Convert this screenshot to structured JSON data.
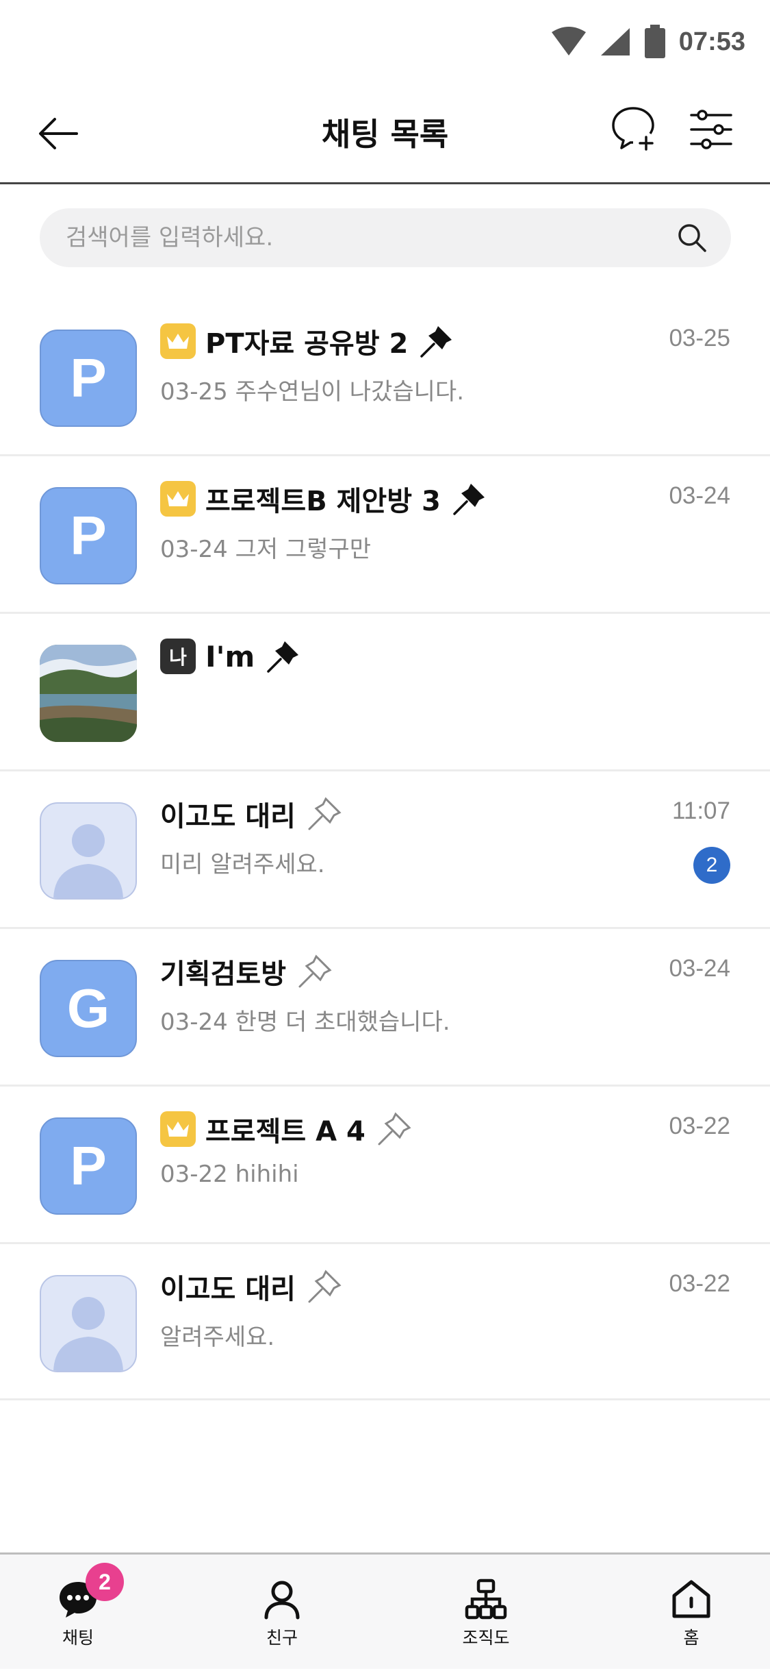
{
  "status_bar": {
    "time": "07:53",
    "icons": [
      "wifi-icon",
      "signal-icon",
      "battery-icon"
    ]
  },
  "header": {
    "title": "채팅 목록",
    "back_icon": "arrow-left-icon",
    "new_chat_icon": "chat-bubble-plus-icon",
    "settings_icon": "sliders-icon"
  },
  "search": {
    "placeholder": "검색어를 입력하세요.",
    "icon": "search-icon"
  },
  "colors": {
    "accent_blue": "#7fabef",
    "unread_badge": "#2f6cc9",
    "tab_badge": "#e8408f",
    "crown": "#f5c542"
  },
  "chats": [
    {
      "name": "PT자료 공유방 2",
      "preview": "03-25 주수연님이 나갔습니다.",
      "time": "03-25",
      "avatar_letter": "P",
      "badge": "crown",
      "pinned": true,
      "unread": ""
    },
    {
      "name": "프로젝트B 제안방 3",
      "preview": "03-24 그저 그렇구만",
      "time": "03-24",
      "avatar_letter": "P",
      "badge": "crown",
      "pinned": true,
      "unread": ""
    },
    {
      "name": "I'm",
      "preview": "",
      "time": "",
      "avatar_letter": "",
      "badge": "me",
      "badge_text": "나",
      "pinned": true,
      "unread": ""
    },
    {
      "name": "이고도 대리",
      "preview": "미리 알려주세요.",
      "time": "11:07",
      "avatar_letter": "",
      "badge": "",
      "pinned": false,
      "unread": "2"
    },
    {
      "name": "기획검토방",
      "preview": "03-24 한명 더 초대했습니다.",
      "time": "03-24",
      "avatar_letter": "G",
      "badge": "",
      "pinned": false,
      "unread": ""
    },
    {
      "name": "프로젝트 A 4",
      "preview": "03-22 hihihi",
      "time": "03-22",
      "avatar_letter": "P",
      "badge": "crown",
      "pinned": false,
      "unread": ""
    },
    {
      "name": "이고도 대리",
      "preview": "알려주세요.",
      "time": "03-22",
      "avatar_letter": "",
      "badge": "",
      "pinned": false,
      "unread": ""
    }
  ],
  "tabbar": {
    "tabs": [
      {
        "label": "채팅",
        "icon": "chat-icon",
        "badge": "2"
      },
      {
        "label": "친구",
        "icon": "person-icon",
        "badge": ""
      },
      {
        "label": "조직도",
        "icon": "org-chart-icon",
        "badge": ""
      },
      {
        "label": "홈",
        "icon": "home-icon",
        "badge": ""
      }
    ]
  }
}
